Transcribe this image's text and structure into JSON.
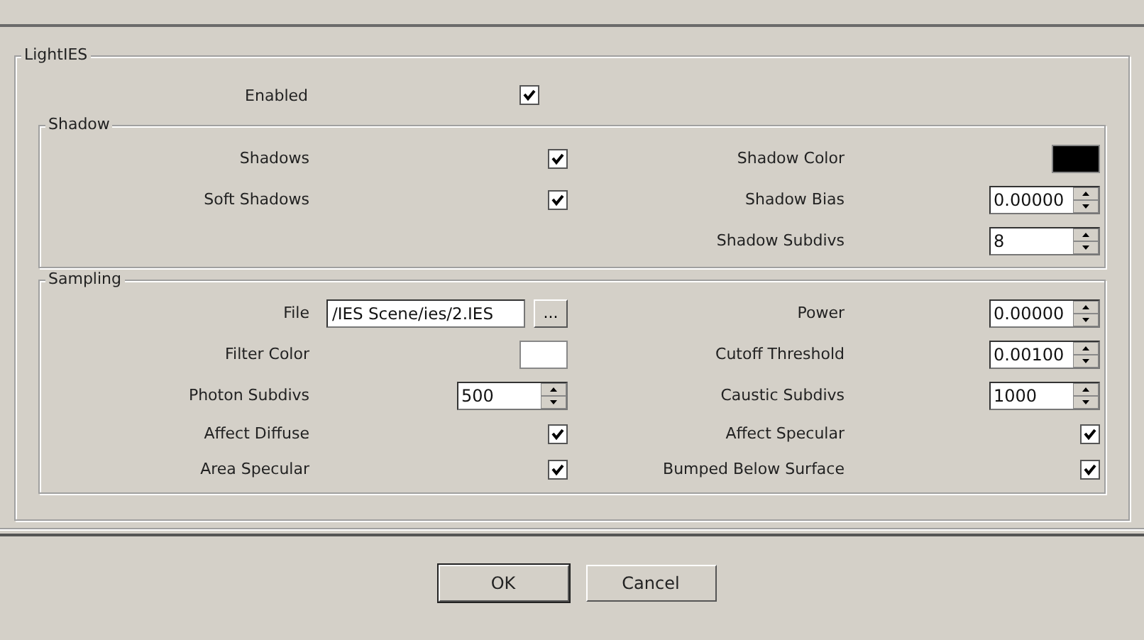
{
  "group": {
    "title": "LightIES",
    "fields": [
      {
        "label": "Enabled",
        "kind": "checkbox",
        "checked": true
      }
    ]
  },
  "sections": [
    {
      "title": "Shadow",
      "rows": [
        {
          "left": {
            "label": "Shadows",
            "kind": "checkbox",
            "checked": true
          },
          "right": {
            "label": "Shadow Color",
            "kind": "color",
            "color": "#000000"
          }
        },
        {
          "left": {
            "label": "Soft Shadows",
            "kind": "checkbox",
            "checked": true
          },
          "right": {
            "label": "Shadow Bias",
            "kind": "spinner",
            "value": "0.00000"
          }
        },
        {
          "right": {
            "label": "Shadow Subdivs",
            "kind": "spinner",
            "value": "8"
          }
        }
      ]
    },
    {
      "title": "Sampling",
      "rows": [
        {
          "left": {
            "label": "File",
            "kind": "file",
            "value": "/IES Scene/ies/2.IES",
            "button": "..."
          },
          "right": {
            "label": "Power",
            "kind": "spinner",
            "value": "0.00000"
          }
        },
        {
          "left": {
            "label": "Filter Color",
            "kind": "color",
            "color": "#ffffff"
          },
          "right": {
            "label": "Cutoff Threshold",
            "kind": "spinner",
            "value": "0.00100"
          }
        },
        {
          "left": {
            "label": "Photon Subdivs",
            "kind": "spinner",
            "value": "500"
          },
          "right": {
            "label": "Caustic Subdivs",
            "kind": "spinner",
            "value": "1000"
          }
        },
        {
          "left": {
            "label": "Affect Diffuse",
            "kind": "checkbox",
            "checked": true
          },
          "right": {
            "label": "Affect Specular",
            "kind": "checkbox",
            "checked": true
          }
        },
        {
          "left": {
            "label": "Area Specular",
            "kind": "checkbox",
            "checked": true
          },
          "right": {
            "label": "Bumped Below Surface",
            "kind": "checkbox",
            "checked": true
          }
        }
      ]
    }
  ],
  "buttons": [
    {
      "label": "OK",
      "default": true
    },
    {
      "label": "Cancel",
      "default": false
    }
  ]
}
